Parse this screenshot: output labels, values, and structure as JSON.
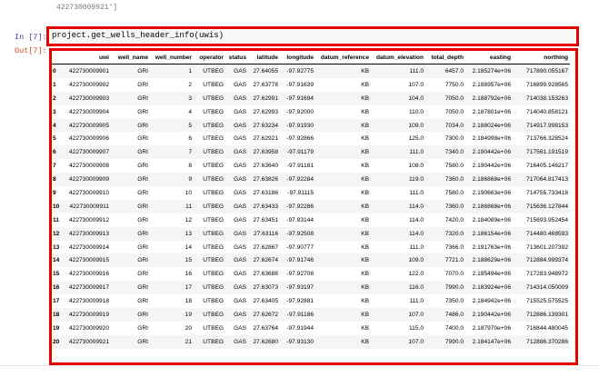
{
  "previous_output": {
    "text": "422730009921']"
  },
  "input_cell": {
    "prompt": "In [7]:",
    "code": "project.get_wells_header_info(uwis)"
  },
  "output_cell": {
    "prompt": "Out[7]:"
  },
  "table": {
    "columns": [
      "",
      "uwi",
      "well_name",
      "well_number",
      "operator",
      "status",
      "latitude",
      "longitude",
      "datum_reference",
      "datum_elevation",
      "total_depth",
      "easting",
      "northing"
    ],
    "rows": [
      [
        "0",
        "422730009901",
        "GRI",
        "1",
        "UTBEG",
        "GAS",
        "27.64055",
        "-97.92775",
        "KB",
        "111.0",
        "6457.0",
        "2.185274e+06",
        "717890.055167"
      ],
      [
        "1",
        "422730009902",
        "GRI",
        "2",
        "UTBEG",
        "GAS",
        "27.63778",
        "-97.91639",
        "KB",
        "107.0",
        "7750.0",
        "2.188957e+06",
        "716899.928565"
      ],
      [
        "2",
        "422730009903",
        "GRI",
        "3",
        "UTBEG",
        "GAS",
        "27.62991",
        "-97.91694",
        "KB",
        "104.0",
        "7050.0",
        "2.188792e+06",
        "714038.153263"
      ],
      [
        "3",
        "422730009904",
        "GRI",
        "4",
        "UTBEG",
        "GAS",
        "27.62993",
        "-97.92000",
        "KB",
        "110.0",
        "7050.0",
        "2.187801e+06",
        "714040.858121"
      ],
      [
        "4",
        "422730009905",
        "GRI",
        "5",
        "UTBEG",
        "GAS",
        "27.63234",
        "-97.91930",
        "KB",
        "109.0",
        "7034.0",
        "2.188024e+06",
        "714917.998153"
      ],
      [
        "5",
        "422730009906",
        "GRI",
        "6",
        "UTBEG",
        "GAS",
        "27.62921",
        "-97.92866",
        "KB",
        "125.0",
        "7300.0",
        "2.184998e+06",
        "713766.328524"
      ],
      [
        "6",
        "422730009907",
        "GRI",
        "7",
        "UTBEG",
        "GAS",
        "27.63958",
        "-97.91179",
        "KB",
        "111.0",
        "7340.0",
        "2.190442e+06",
        "717561.191519"
      ],
      [
        "7",
        "422730009908",
        "GRI",
        "8",
        "UTBEG",
        "GAS",
        "27.63640",
        "-97.91181",
        "KB",
        "108.0",
        "7580.0",
        "2.190442e+06",
        "716405.146217"
      ],
      [
        "8",
        "422730009909",
        "GRI",
        "9",
        "UTBEG",
        "GAS",
        "27.63826",
        "-97.92284",
        "KB",
        "119.0",
        "7360.0",
        "2.186868e+06",
        "717064.817413"
      ],
      [
        "9",
        "422730009910",
        "GRI",
        "10",
        "UTBEG",
        "GAS",
        "27.63186",
        "-97.91115",
        "KB",
        "111.0",
        "7580.0",
        "2.190663e+06",
        "714755.733418"
      ],
      [
        "10",
        "422730009911",
        "GRI",
        "11",
        "UTBEG",
        "GAS",
        "27.63433",
        "-97.92286",
        "KB",
        "114.0",
        "7360.0",
        "2.186868e+06",
        "715636.127844"
      ],
      [
        "11",
        "422730009912",
        "GRI",
        "12",
        "UTBEG",
        "GAS",
        "27.63451",
        "-97.93144",
        "KB",
        "114.0",
        "7420.0",
        "2.184089e+06",
        "715693.952454"
      ],
      [
        "12",
        "422730009913",
        "GRI",
        "13",
        "UTBEG",
        "GAS",
        "27.63116",
        "-97.92508",
        "KB",
        "114.0",
        "7320.0",
        "2.186154e+06",
        "714480.468593"
      ],
      [
        "13",
        "422730009914",
        "GRI",
        "14",
        "UTBEG",
        "GAS",
        "27.62867",
        "-97.90777",
        "KB",
        "111.0",
        "7366.0",
        "2.191763e+06",
        "713601.207392"
      ],
      [
        "14",
        "422730009915",
        "GRI",
        "15",
        "UTBEG",
        "GAS",
        "27.62674",
        "-97.91746",
        "KB",
        "109.0",
        "7721.0",
        "2.188629e+06",
        "712884.999374"
      ],
      [
        "15",
        "422730009916",
        "GRI",
        "16",
        "UTBEG",
        "GAS",
        "27.63688",
        "-97.92708",
        "KB",
        "122.0",
        "7070.0",
        "2.185494e+06",
        "717283.948972"
      ],
      [
        "16",
        "422730009917",
        "GRI",
        "17",
        "UTBEG",
        "GAS",
        "27.63073",
        "-97.93197",
        "KB",
        "116.0",
        "7990.0",
        "2.183924e+06",
        "714314.050009"
      ],
      [
        "17",
        "422730009918",
        "GRI",
        "18",
        "UTBEG",
        "GAS",
        "27.63405",
        "-97.92881",
        "KB",
        "111.0",
        "7350.0",
        "2.184942e+06",
        "715525.575525"
      ],
      [
        "18",
        "422730009919",
        "GRI",
        "19",
        "UTBEG",
        "GAS",
        "27.62672",
        "-97.91186",
        "KB",
        "107.0",
        "7486.0",
        "2.190442e+06",
        "712886.139301"
      ],
      [
        "19",
        "422730009920",
        "GRI",
        "20",
        "UTBEG",
        "GAS",
        "27.63764",
        "-97.91944",
        "KB",
        "115.0",
        "7400.0",
        "2.187970e+06",
        "716844.480045"
      ],
      [
        "20",
        "422730009921",
        "GRI",
        "21",
        "UTBEG",
        "GAS",
        "27.62680",
        "-97.93130",
        "KB",
        "107.0",
        "7990.0",
        "2.184147e+06",
        "712886.370286"
      ]
    ]
  },
  "colors": {
    "highlight_border": "#e50000",
    "in_prompt": "#303f9f",
    "out_prompt": "#d84315"
  }
}
